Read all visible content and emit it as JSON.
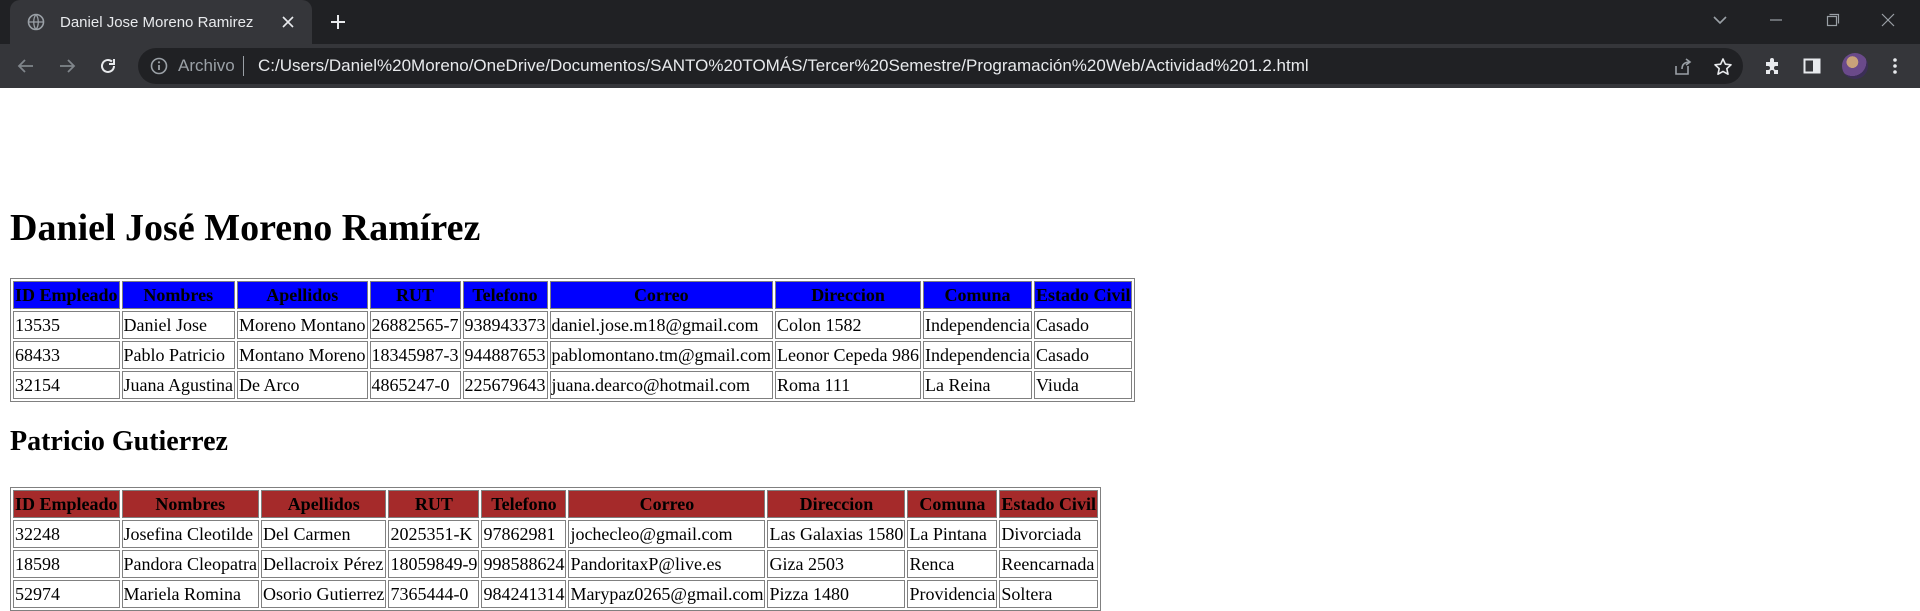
{
  "browser": {
    "tab_title": "Daniel Jose Moreno Ramirez",
    "scheme_label": "Archivo",
    "url": "C:/Users/Daniel%20Moreno/OneDrive/Documentos/SANTO%20TOMÁS/Tercer%20Semestre/Programación%20Web/Actividad%201.2.html"
  },
  "page": {
    "heading1": "Daniel José Moreno Ramírez",
    "table1": {
      "header_color": "#0000ff",
      "headers": [
        "ID Empleado",
        "Nombres",
        "Apellidos",
        "RUT",
        "Telefono",
        "Correo",
        "Direccion",
        "Comuna",
        "Estado Civil"
      ],
      "rows": [
        [
          "13535",
          "Daniel Jose",
          "Moreno Montano",
          "26882565-7",
          "938943373",
          "daniel.jose.m18@gmail.com",
          "Colon 1582",
          "Independencia",
          "Casado"
        ],
        [
          "68433",
          "Pablo Patricio",
          "Montano Moreno",
          "18345987-3",
          "944887653",
          "pablomontano.tm@gmail.com",
          "Leonor Cepeda 986",
          "Independencia",
          "Casado"
        ],
        [
          "32154",
          "Juana Agustina",
          "De Arco",
          "4865247-0",
          "225679643",
          "juana.dearco@hotmail.com",
          "Roma 111",
          "La Reina",
          "Viuda"
        ]
      ]
    },
    "heading2": "Patricio Gutierrez",
    "table2": {
      "header_color": "#a52a2a",
      "headers": [
        "ID Empleado",
        "Nombres",
        "Apellidos",
        "RUT",
        "Telefono",
        "Correo",
        "Direccion",
        "Comuna",
        "Estado Civil"
      ],
      "rows": [
        [
          "32248",
          "Josefina Cleotilde",
          "Del Carmen",
          "2025351-K",
          "97862981",
          "jochecleo@gmail.com",
          "Las Galaxias 1580",
          "La Pintana",
          "Divorciada"
        ],
        [
          "18598",
          "Pandora Cleopatra",
          "Dellacroix Pérez",
          "18059849-9",
          "998588624",
          "PandoritaxP@live.es",
          "Giza 2503",
          "Renca",
          "Reencarnada"
        ],
        [
          "52974",
          "Mariela Romina",
          "Osorio Gutierrez",
          "7365444-0",
          "984241314",
          "Marypaz0265@gmail.com",
          "Pizza 1480",
          "Providencia",
          "Soltera"
        ]
      ]
    }
  }
}
